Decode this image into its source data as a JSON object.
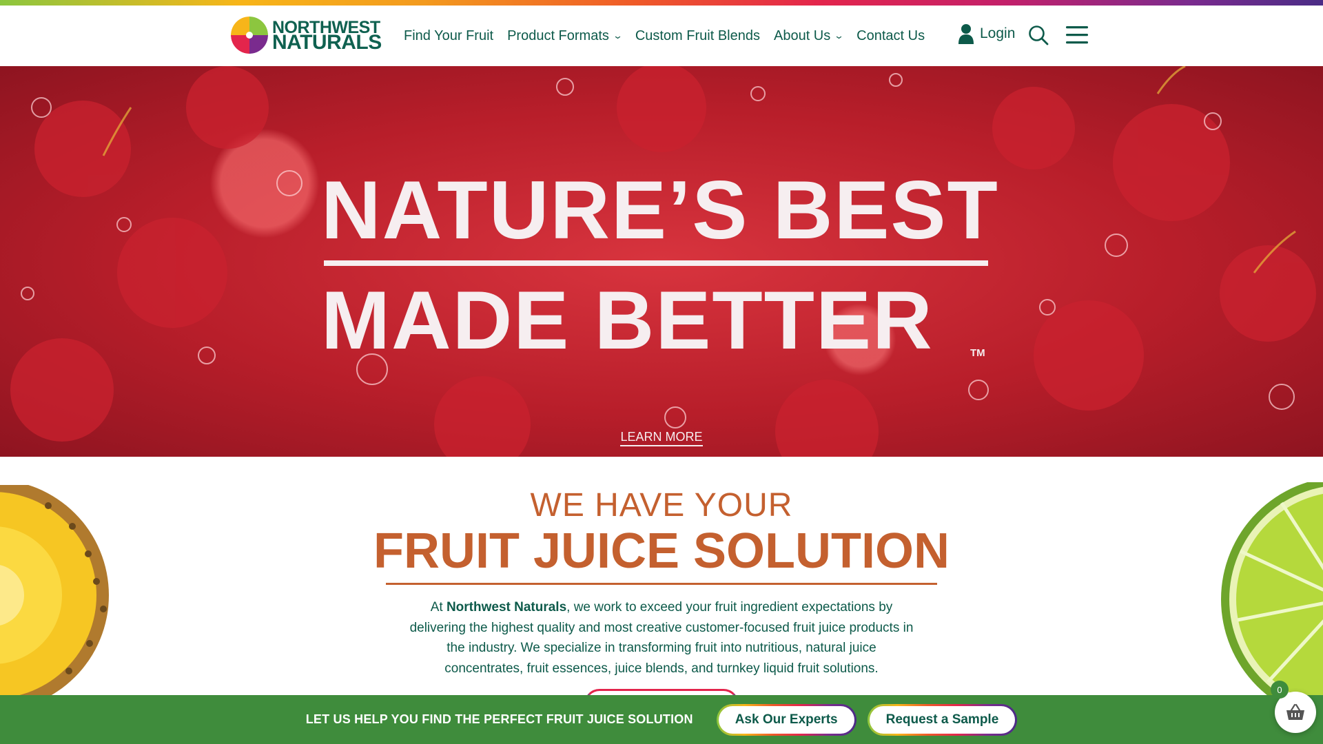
{
  "brand": {
    "line1": "NORTHWEST",
    "line2": "NATURALS",
    "colors": {
      "primary_green": "#0d5a4a",
      "accent_orange": "#c4602f",
      "cta_green": "#3f8c3c"
    }
  },
  "nav": {
    "items": [
      {
        "label": "Find Your Fruit",
        "has_dropdown": false
      },
      {
        "label": "Product Formats",
        "has_dropdown": true
      },
      {
        "label": "Custom Fruit Blends",
        "has_dropdown": false
      },
      {
        "label": "About Us",
        "has_dropdown": true
      },
      {
        "label": "Contact Us",
        "has_dropdown": false
      }
    ],
    "login_label": "Login",
    "icons": {
      "login": "user-icon",
      "search": "search-icon",
      "menu": "hamburger-menu-icon",
      "dropdown": "chevron-down-icon"
    }
  },
  "hero": {
    "title_line1": "NATURE’S BEST",
    "title_line2": "MADE BETTER",
    "trademark": "TM",
    "learn_more": "LEARN MORE"
  },
  "solution": {
    "subtitle": "WE HAVE YOUR",
    "title": "FRUIT JUICE SOLUTION",
    "body_prefix": "At ",
    "body_brand": "Northwest Naturals",
    "body_rest": ", we work to exceed your fruit ingredient expectations by delivering the highest quality and most creative customer-focused fruit juice products in the industry. We specialize in transforming fruit into nutritious, natural juice concentrates, fruit essences, juice blends, and turnkey liquid fruit solutions."
  },
  "cta_bar": {
    "text": "LET US HELP YOU FIND THE PERFECT FRUIT JUICE SOLUTION",
    "button1": "Ask Our Experts",
    "button2": "Request a Sample"
  },
  "cart": {
    "count": "0",
    "icon": "basket-icon"
  }
}
